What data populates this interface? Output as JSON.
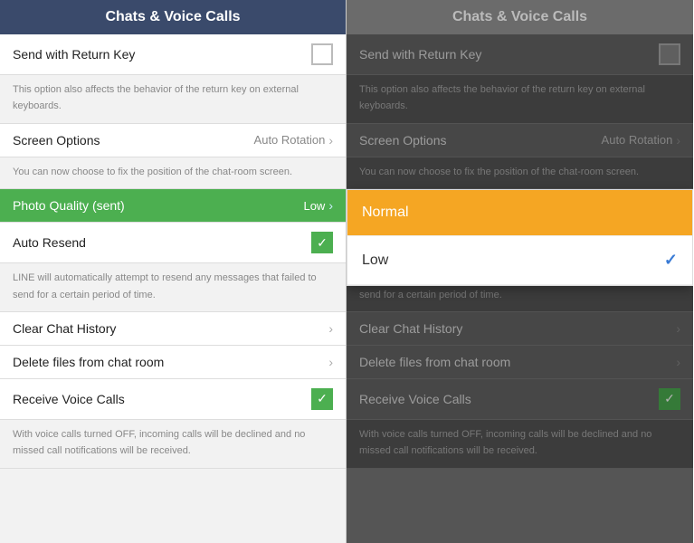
{
  "left_panel": {
    "header": "Chats & Voice Calls",
    "items": [
      {
        "id": "send-return-key",
        "label": "Send with Return Key",
        "type": "checkbox",
        "checked": false,
        "description": ""
      },
      {
        "id": "send-return-key-desc",
        "type": "description",
        "text": "This option also affects the behavior of the return key on external keyboards."
      },
      {
        "id": "screen-options",
        "label": "Screen Options",
        "type": "value-arrow",
        "value": "Auto Rotation",
        "description": ""
      },
      {
        "id": "screen-options-desc",
        "type": "description",
        "text": "You can now choose to fix the position of the chat-room screen."
      },
      {
        "id": "photo-quality",
        "label": "Photo Quality (sent)",
        "type": "value-arrow",
        "value": "Low",
        "highlighted": true,
        "description": ""
      },
      {
        "id": "auto-resend",
        "label": "Auto Resend",
        "type": "checkbox",
        "checked": true,
        "description": ""
      },
      {
        "id": "auto-resend-desc",
        "type": "description",
        "text": "LINE will automatically attempt to resend any messages that failed to send for a certain period of time."
      },
      {
        "id": "clear-chat-history",
        "label": "Clear Chat History",
        "type": "arrow",
        "description": ""
      },
      {
        "id": "delete-files",
        "label": "Delete files from chat room",
        "type": "arrow",
        "description": ""
      },
      {
        "id": "receive-voice-calls",
        "label": "Receive Voice Calls",
        "type": "checkbox",
        "checked": true,
        "description": ""
      },
      {
        "id": "receive-voice-calls-desc",
        "type": "description",
        "text": "With voice calls turned OFF, incoming calls will be declined and no missed call notifications will be received."
      }
    ]
  },
  "right_panel": {
    "header": "Chats & Voice Calls",
    "items": [
      {
        "id": "send-return-key",
        "label": "Send with Return Key",
        "type": "checkbox",
        "checked": false,
        "description": ""
      },
      {
        "id": "send-return-key-desc",
        "type": "description",
        "text": "This option also affects the behavior of the return key on external keyboards."
      },
      {
        "id": "screen-options",
        "label": "Screen Options",
        "type": "value-arrow",
        "value": "Auto Rotation",
        "description": ""
      },
      {
        "id": "screen-options-desc",
        "type": "description",
        "text": "You can now choose to fix the position of the chat-room screen."
      },
      {
        "id": "photo-quality",
        "label": "Photo Quality (sent)",
        "type": "value-arrow-dropdown",
        "value": "Low",
        "highlighted": true,
        "dropdown": {
          "options": [
            {
              "id": "normal",
              "label": "Normal",
              "selected": false
            },
            {
              "id": "low",
              "label": "Low",
              "selected": true
            }
          ]
        },
        "description": ""
      },
      {
        "id": "auto-resend",
        "label": "Auto Resend",
        "type": "checkbox",
        "checked": true,
        "description": ""
      },
      {
        "id": "auto-resend-desc",
        "type": "description",
        "text": "LINE will automatically attempt to resend any messages that failed to send for a certain period of time."
      },
      {
        "id": "clear-chat-history",
        "label": "Clear Chat History",
        "type": "arrow",
        "description": ""
      },
      {
        "id": "delete-files",
        "label": "Delete files from chat room",
        "type": "arrow",
        "description": ""
      },
      {
        "id": "receive-voice-calls",
        "label": "Receive Voice Calls",
        "type": "checkbox",
        "checked": true,
        "description": ""
      },
      {
        "id": "receive-voice-calls-desc",
        "type": "description",
        "text": "With voice calls turned OFF, incoming calls will be declined and no missed call notifications will be received."
      }
    ],
    "dropdown": {
      "options": [
        {
          "id": "normal",
          "label": "Normal",
          "selected": false
        },
        {
          "id": "low",
          "label": "Low",
          "selected": true
        }
      ]
    }
  }
}
